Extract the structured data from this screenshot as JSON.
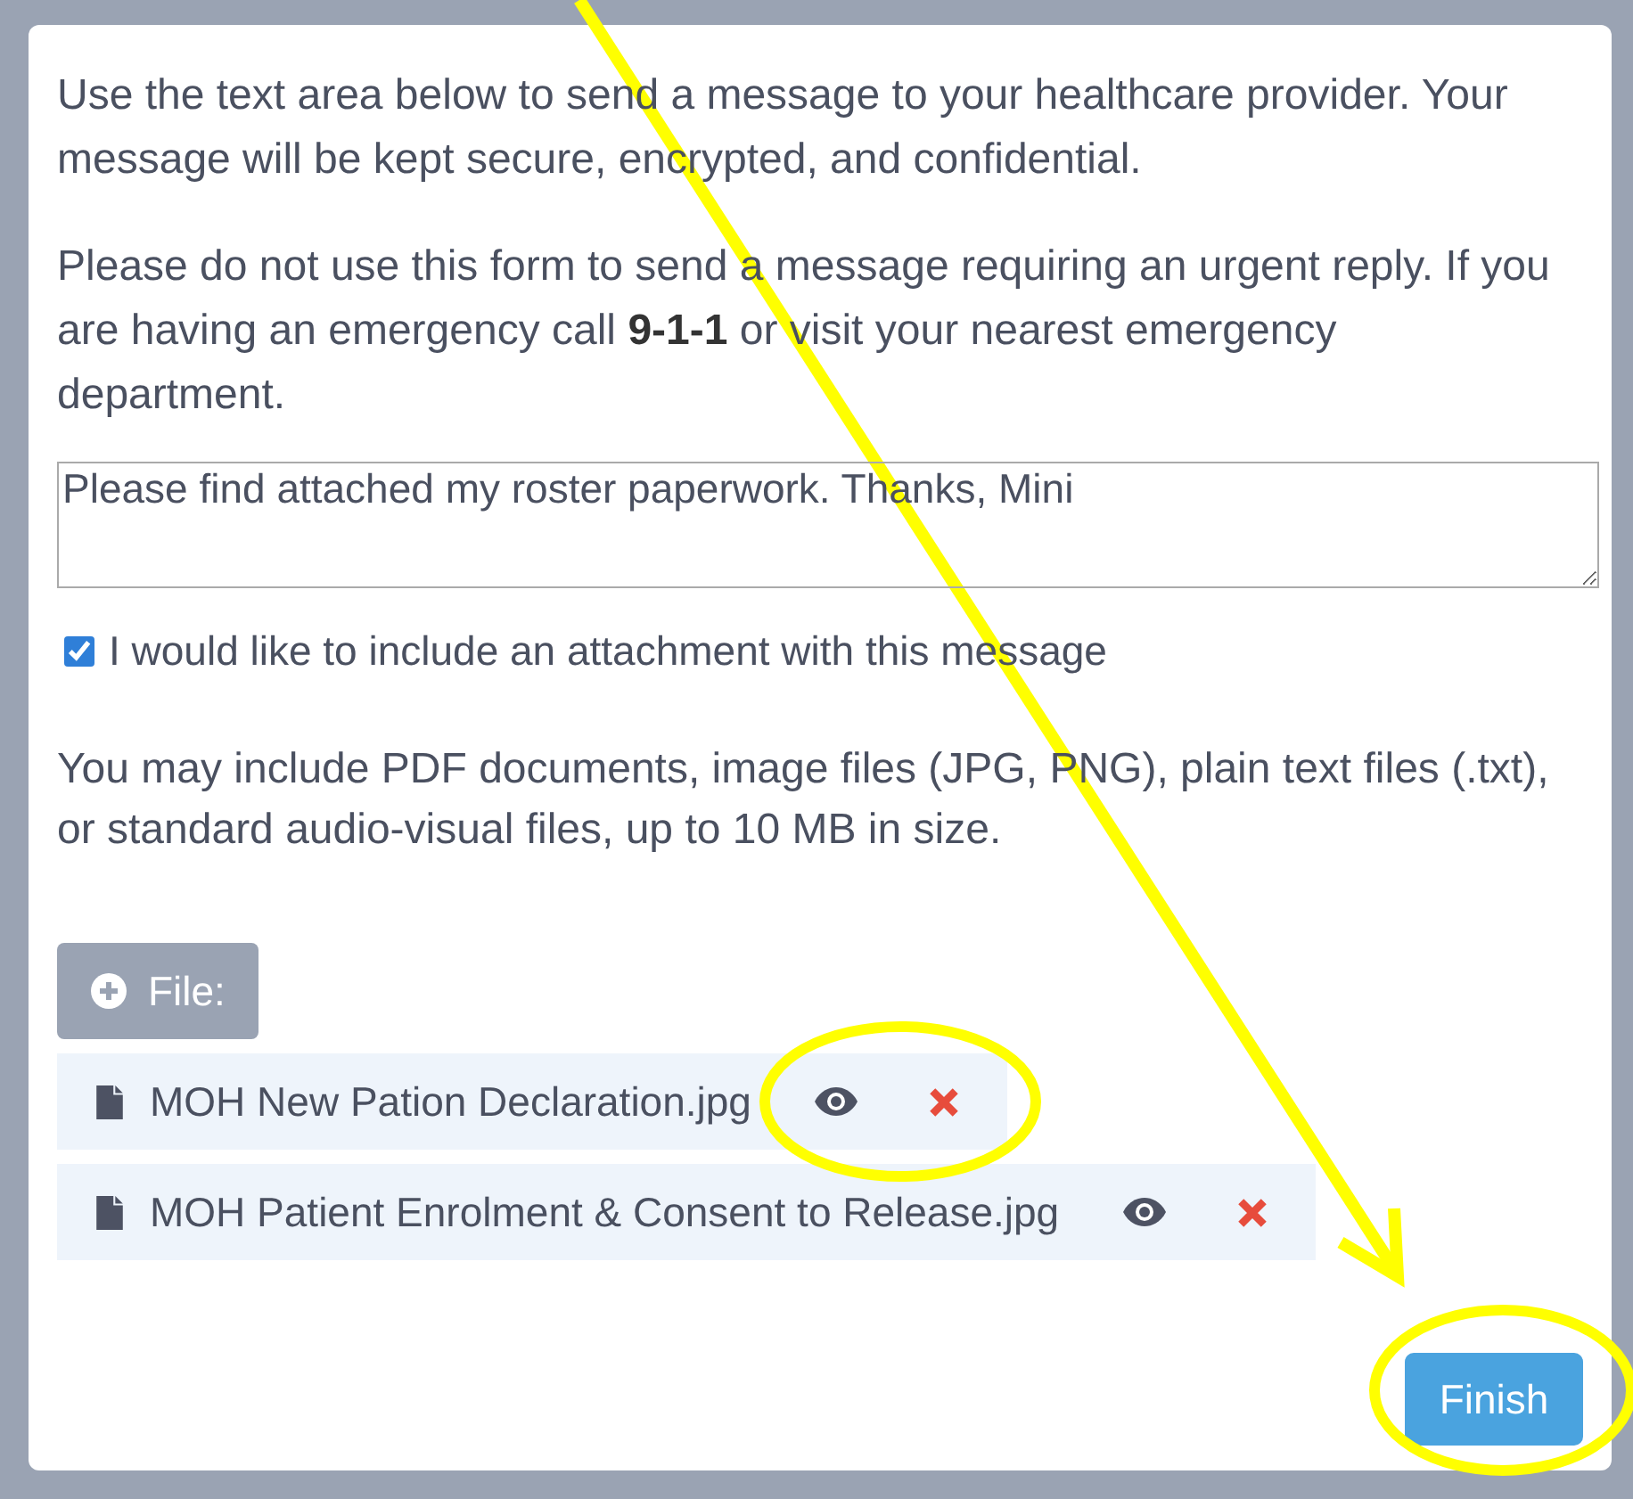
{
  "intro": "Use the text area below to send a message to your healthcare provider. Your message will be kept secure, encrypted, and confidential.",
  "warning": "Please do not use this form to send a message requiring an urgent reply. If you are having an emergency call **9-1-1** or visit your nearest emergency department.",
  "message": {
    "value": "Please find attached my roster paperwork. Thanks, Mini"
  },
  "attachment": {
    "label": "I would like to include an attachment with this message",
    "checked": true
  },
  "file_types_note": "You may include PDF documents, image files (JPG, PNG), plain text files (.txt), or standard audio-visual files, up to 10 MB in size.",
  "add_file_button": "File:",
  "files": [
    {
      "name": "MOH New Pation Declaration.jpg"
    },
    {
      "name": "MOH Patient Enrolment & Consent to Release.jpg"
    }
  ],
  "finish_button": "Finish"
}
